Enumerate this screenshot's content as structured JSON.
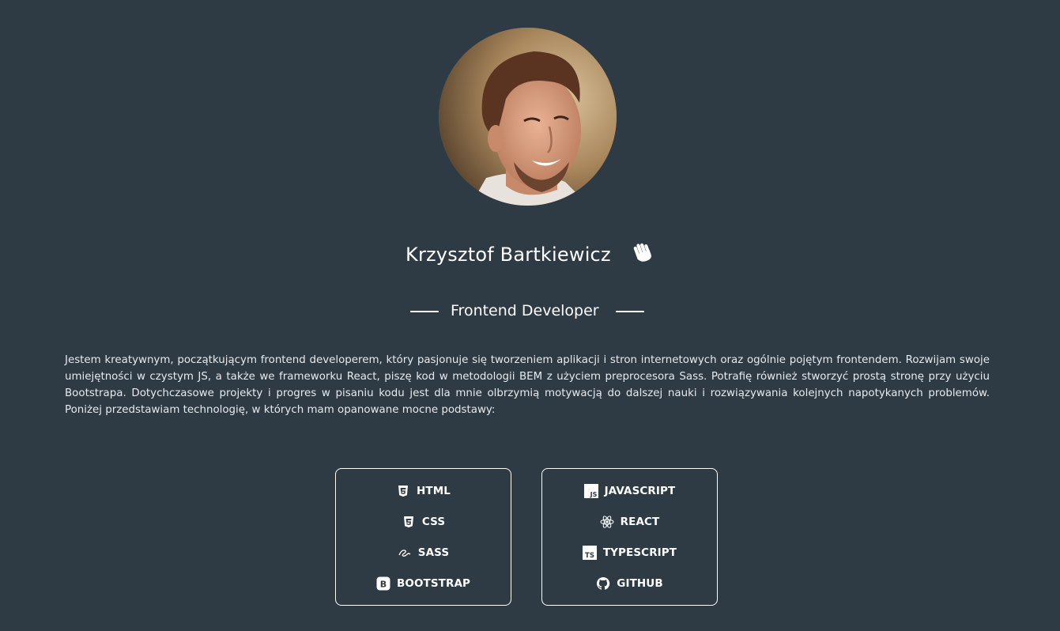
{
  "profile": {
    "name": "Krzysztof Bartkiewicz",
    "role": "Frontend Developer",
    "bio": "Jestem kreatywnym, początkującym frontend developerem, który pasjonuje się tworzeniem aplikacji i stron internetowych oraz ogólnie pojętym frontendem. Rozwijam swoje umiejętności w czystym JS, a także we frameworku React, piszę kod w metodologii BEM z użyciem preprocesora Sass. Potrafię również stworzyć prostą stronę przy użyciu Bootstrapa. Dotychczasowe projekty i progres w pisaniu kodu jest dla mnie olbrzymią motywacją do dalszej nauki i rozwiązywania kolejnych napotykanych problemów. Poniżej przedstawiam technologię, w których mam opanowane mocne podstawy:"
  },
  "colors": {
    "background": "#2e3b45",
    "text": "#ffffff"
  },
  "skills": {
    "left": [
      {
        "label": "HTML",
        "icon": "html5-icon"
      },
      {
        "label": "CSS",
        "icon": "css3-icon"
      },
      {
        "label": "SASS",
        "icon": "sass-icon"
      },
      {
        "label": "BOOTSTRAP",
        "icon": "bootstrap-icon"
      }
    ],
    "right": [
      {
        "label": "JAVASCRIPT",
        "icon": "javascript-icon"
      },
      {
        "label": "REACT",
        "icon": "react-icon"
      },
      {
        "label": "TYPESCRIPT",
        "icon": "typescript-icon"
      },
      {
        "label": "GITHUB",
        "icon": "github-icon"
      }
    ]
  }
}
